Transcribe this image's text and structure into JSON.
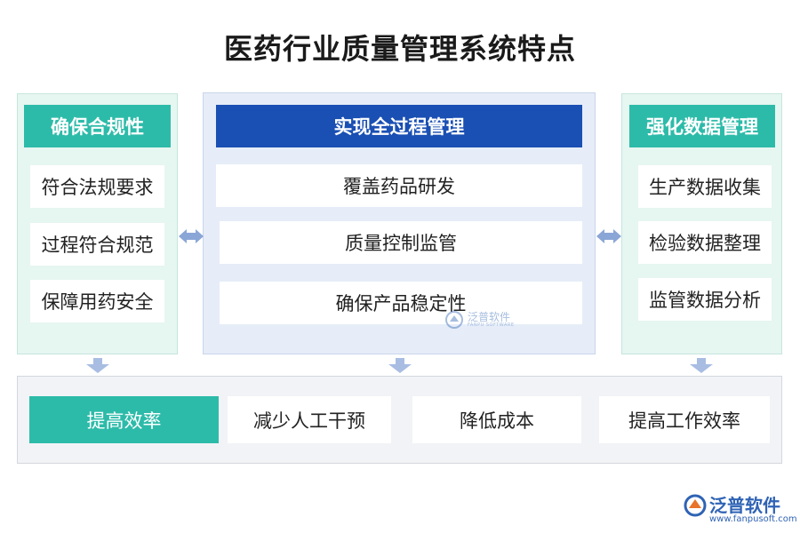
{
  "title": "医药行业质量管理系统特点",
  "left": {
    "header": "确保合规性",
    "items": [
      "符合法规要求",
      "过程符合规范",
      "保障用药安全"
    ]
  },
  "middle": {
    "header": "实现全过程管理",
    "items": [
      "覆盖药品研发",
      "质量控制监管",
      "确保产品稳定性"
    ]
  },
  "right": {
    "header": "强化数据管理",
    "items": [
      "生产数据收集",
      "检验数据整理",
      "监管数据分析"
    ]
  },
  "bottom": {
    "header": "提高效率",
    "items": [
      "减少人工干预",
      "降低成本",
      "提高工作效率"
    ]
  },
  "watermark": {
    "text": "泛普软件",
    "sub": "FANPU SOFTWARE"
  },
  "brand": {
    "name": "泛普软件",
    "url": "www.fanpusoft.com"
  },
  "colors": {
    "teal": "#2dbba9",
    "blue": "#1a4fb3",
    "arrow": "#8aa6d6",
    "brand": "#2f63b5"
  }
}
